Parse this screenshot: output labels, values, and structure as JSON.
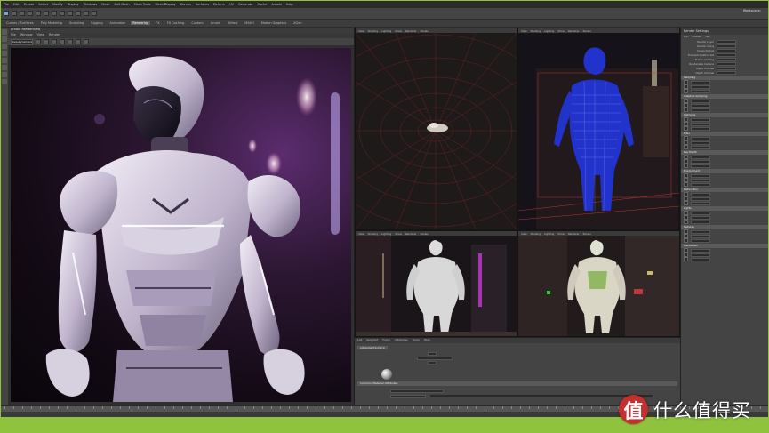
{
  "menubar": {
    "items": [
      "File",
      "Edit",
      "Create",
      "Select",
      "Modify",
      "Display",
      "Windows",
      "Mesh",
      "Edit Mesh",
      "Mesh Tools",
      "Mesh Display",
      "Curves",
      "Surfaces",
      "Deform",
      "UV",
      "Generate",
      "Cache",
      "Arnold",
      "Help"
    ]
  },
  "toolbar": {
    "workspace_label": "Workspace:"
  },
  "shelf": {
    "tabs": [
      "Curves / Surfaces",
      "Poly Modeling",
      "Sculpting",
      "Rigging",
      "Animation",
      "Rendering",
      "FX",
      "FX Caching",
      "Custom",
      "Arnold",
      "Bifrost",
      "MASH",
      "Motion Graphics",
      "XGen"
    ]
  },
  "render_view": {
    "title": "Arnold RenderView",
    "menu": [
      "File",
      "Window",
      "View",
      "Render"
    ],
    "camera_select": "beautyCamera"
  },
  "viewports": {
    "menu": [
      "View",
      "Shading",
      "Lighting",
      "Show",
      "Renderer",
      "Panels"
    ],
    "top_right_label": "persp"
  },
  "attribute_editor": {
    "title": "Render Settings",
    "menu": [
      "Edit",
      "Presets",
      "Help"
    ],
    "rows": [
      {
        "label": "Render Layer"
      },
      {
        "label": "Render Using"
      },
      {
        "label": "Image format"
      },
      {
        "label": "Frame/Animation ext"
      },
      {
        "label": "Frame padding"
      },
      {
        "label": "Renderable Camera"
      },
      {
        "label": "Alpha channel"
      },
      {
        "label": "Depth channel"
      }
    ],
    "sections": [
      "Sampling",
      "Adaptive Sampling",
      "Clamping",
      "Filter",
      "Ray Depth",
      "Environment",
      "Motion Blur",
      "Lights",
      "Textures",
      "Subdivision"
    ]
  },
  "editor_panel": {
    "menu": [
      "List",
      "Selected",
      "Focus",
      "Attributes",
      "Show",
      "Help"
    ],
    "tab": "aiStandardSurface",
    "section_label": "Common Material Attributes"
  },
  "watermark": {
    "logo_char": "值",
    "text": "什么值得买"
  },
  "colors": {
    "accent_green": "#8fc23d",
    "watermark_red": "#c62f2f",
    "viewport_wire_blue": "#2233cc"
  }
}
